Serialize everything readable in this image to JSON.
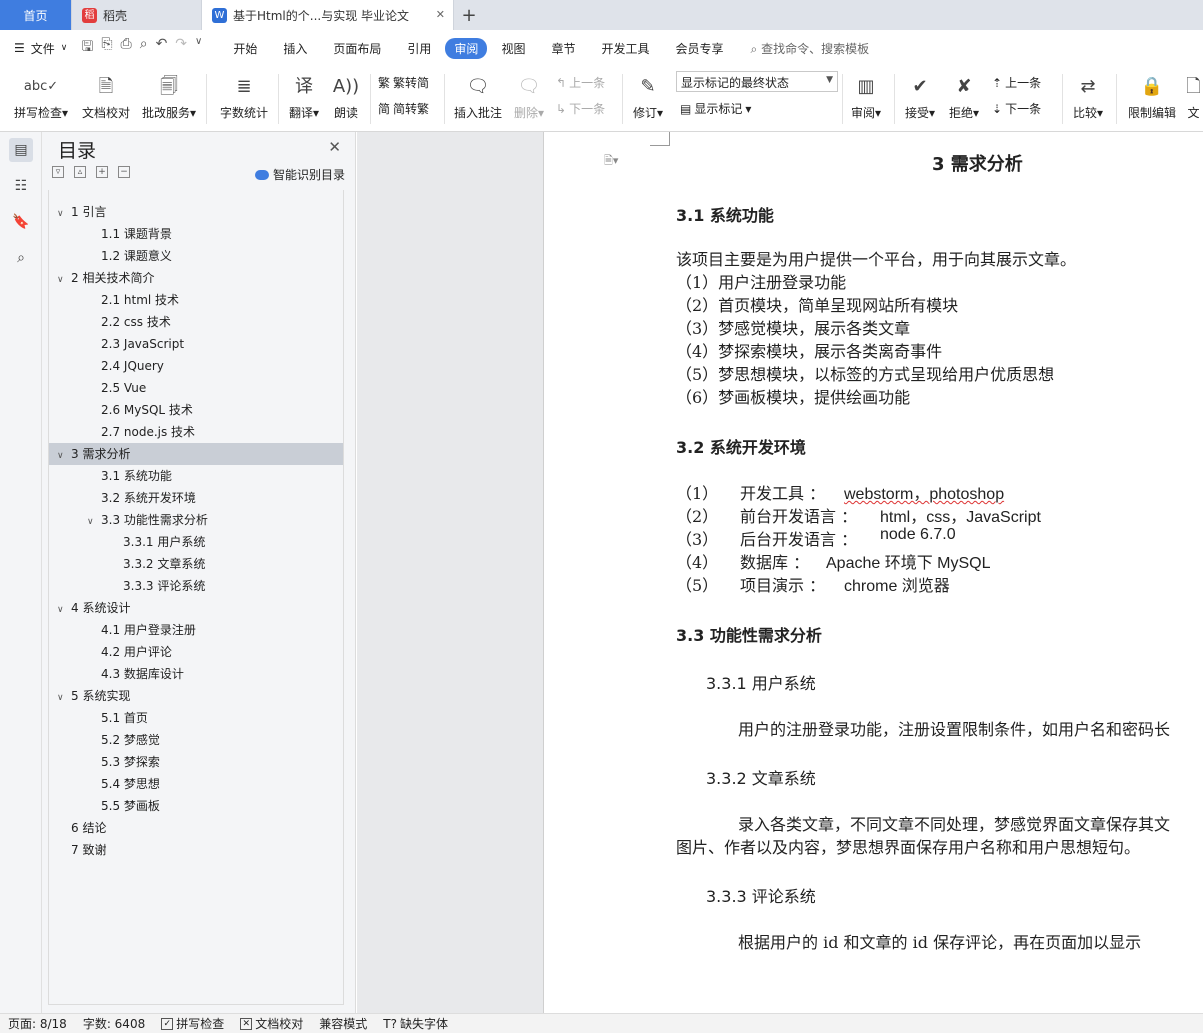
{
  "tabs": {
    "home": "首页",
    "daoke": "稻壳",
    "doc": "基于Html的个...与实现 毕业论文"
  },
  "menu": {
    "file": "文件",
    "items": [
      "开始",
      "插入",
      "页面布局",
      "引用",
      "审阅",
      "视图",
      "章节",
      "开发工具",
      "会员专享"
    ],
    "active": "审阅",
    "search": "查找命令、搜索模板"
  },
  "ribbon": {
    "spell": "拼写检查",
    "proofread": "文档校对",
    "review_service": "批改服务",
    "word_count": "字数统计",
    "translate": "翻译",
    "read_aloud": "朗读",
    "to_trad": "繁转简",
    "to_simp": "简转繁",
    "insert_comment": "插入批注",
    "delete": "删除",
    "prev_comment": "上一条",
    "next_comment": "下一条",
    "revise": "修订",
    "markup_select": "显示标记的最终状态",
    "show_markup": "显示标记",
    "review": "审阅",
    "accept": "接受",
    "reject": "拒绝",
    "prev": "上一条",
    "next": "下一条",
    "compare": "比较",
    "restrict": "限制编辑",
    "more": "文"
  },
  "toc": {
    "title": "目录",
    "smart": "智能识别目录",
    "items": [
      {
        "text": "1 引言",
        "level": 1,
        "expand": true
      },
      {
        "text": "1.1 课题背景",
        "level": 2
      },
      {
        "text": "1.2 课题意义",
        "level": 2
      },
      {
        "text": "2 相关技术简介",
        "level": 1,
        "expand": true
      },
      {
        "text": "2.1 html 技术",
        "level": 2
      },
      {
        "text": "2.2 css 技术",
        "level": 2
      },
      {
        "text": "2.3 JavaScript",
        "level": 2
      },
      {
        "text": "2.4 JQuery",
        "level": 2
      },
      {
        "text": "2.5 Vue",
        "level": 2
      },
      {
        "text": "2.6 MySQL 技术",
        "level": 2
      },
      {
        "text": "2.7 node.js 技术",
        "level": 2
      },
      {
        "text": "3 需求分析",
        "level": 1,
        "expand": true,
        "selected": true
      },
      {
        "text": "3.1 系统功能",
        "level": 2
      },
      {
        "text": "3.2 系统开发环境",
        "level": 2
      },
      {
        "text": "3.3 功能性需求分析",
        "level": 2,
        "expand": true
      },
      {
        "text": "3.3.1 用户系统",
        "level": 3
      },
      {
        "text": "3.3.2 文章系统",
        "level": 3
      },
      {
        "text": "3.3.3 评论系统",
        "level": 3
      },
      {
        "text": "4 系统设计",
        "level": 1,
        "expand": true
      },
      {
        "text": "4.1 用户登录注册",
        "level": 2
      },
      {
        "text": "4.2 用户评论",
        "level": 2
      },
      {
        "text": "4.3 数据库设计",
        "level": 2
      },
      {
        "text": "5 系统实现",
        "level": 1,
        "expand": true
      },
      {
        "text": "5.1 首页",
        "level": 2
      },
      {
        "text": "5.2 梦感觉",
        "level": 2
      },
      {
        "text": "5.3 梦探索",
        "level": 2
      },
      {
        "text": "5.4 梦思想",
        "level": 2
      },
      {
        "text": "5.5 梦画板",
        "level": 2
      },
      {
        "text": "6 结论",
        "level": 1
      },
      {
        "text": "7 致谢",
        "level": 1
      }
    ]
  },
  "doc": {
    "chapter": "3 需求分析",
    "s31": "3.1  系统功能",
    "s31_intro": "该项目主要是为用户提供一个平台，用于向其展示文章。",
    "s31_items": [
      "（1）用户注册登录功能",
      "（2）首页模块，简单呈现网站所有模块",
      "（3）梦感觉模块，展示各类文章",
      "（4）梦探索模块，展示各类离奇事件",
      "（5）梦思想模块，以标签的方式呈现给用户优质思想",
      "（6）梦画板模块，提供绘画功能"
    ],
    "s32": "3.2  系统开发环境",
    "env": [
      {
        "num": "（1）",
        "label": "开发工具 ：",
        "value": "webstorm，photoshop"
      },
      {
        "num": "（2）",
        "label": "前台开发语言 ：",
        "value": "html，css，JavaScript"
      },
      {
        "num": "（3）",
        "label": "后台开发语言 ：",
        "value": "node 6.7.0"
      },
      {
        "num": "（4）",
        "label": "数据库 ：",
        "value": "Apache 环境下 MySQL"
      },
      {
        "num": "（5）",
        "label": "项目演示 ：",
        "value": "chrome 浏览器"
      }
    ],
    "s33": "3.3 功能性需求分析",
    "s331": "3.3.1 用户系统",
    "s331_text": "用户的注册登录功能，注册设置限制条件，如用户名和密码长",
    "s332": "3.3.2  文章系统",
    "s332_text1": "录入各类文章，不同文章不同处理，梦感觉界面文章保存其文",
    "s332_text2": "图片、作者以及内容，梦思想界面保存用户名称和用户思想短句。",
    "s333": "3.3.3   评论系统",
    "s333_text": "根据用户的 id 和文章的 id 保存评论，再在页面加以显示"
  },
  "status": {
    "page": "页面: 8/18",
    "words": "字数: 6408",
    "spell": "拼写检查",
    "proof": "文档校对",
    "compat": "兼容模式",
    "missing_font": "缺失字体"
  }
}
